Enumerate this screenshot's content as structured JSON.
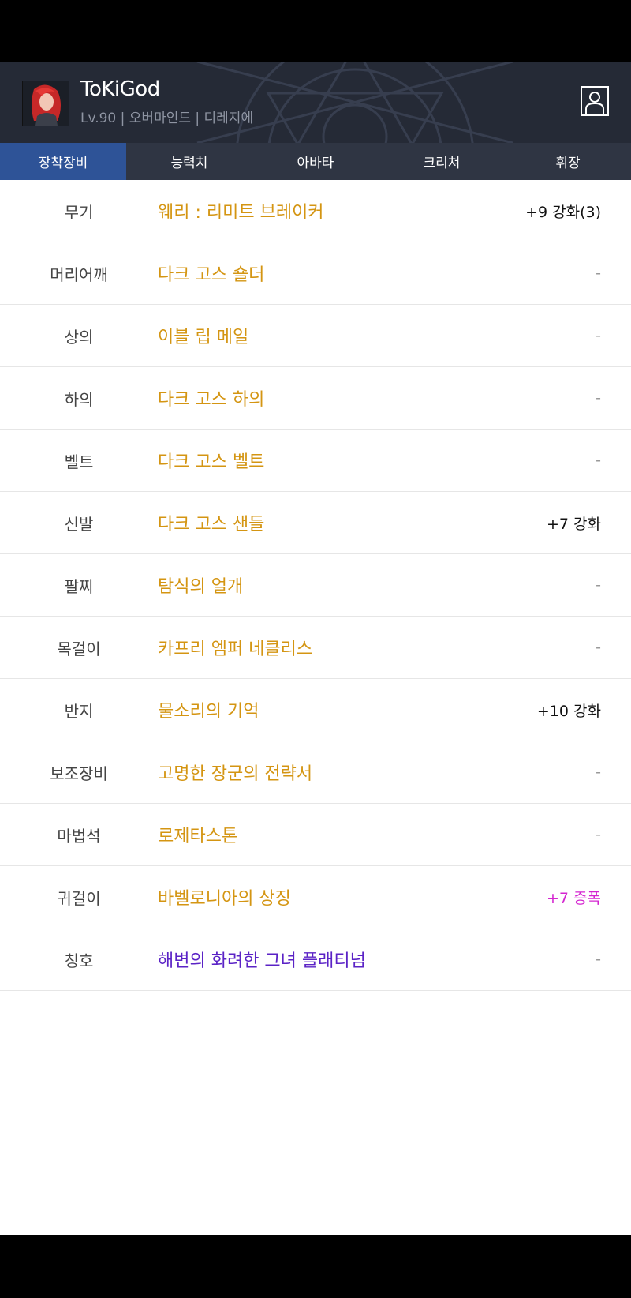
{
  "character": {
    "name": "ToKiGod",
    "info": "Lv.90 | 오버마인드 | 디레지에"
  },
  "tabs": [
    "장착장비",
    "능력치",
    "아바타",
    "크리쳐",
    "휘장"
  ],
  "equipment": [
    {
      "slot": "무기",
      "item": "웨리 : 리미트 브레이커",
      "bonus": "+9 강화(3)"
    },
    {
      "slot": "머리어깨",
      "item": "다크 고스 숄더",
      "bonus": "-"
    },
    {
      "slot": "상의",
      "item": "이블 립 메일",
      "bonus": "-"
    },
    {
      "slot": "하의",
      "item": "다크 고스 하의",
      "bonus": "-"
    },
    {
      "slot": "벨트",
      "item": "다크 고스 벨트",
      "bonus": "-"
    },
    {
      "slot": "신발",
      "item": "다크 고스 샌들",
      "bonus": "+7 강화"
    },
    {
      "slot": "팔찌",
      "item": "탐식의 얼개",
      "bonus": "-"
    },
    {
      "slot": "목걸이",
      "item": "카프리 엠퍼 네클리스",
      "bonus": "-"
    },
    {
      "slot": "반지",
      "item": "물소리의 기억",
      "bonus": "+10 강화"
    },
    {
      "slot": "보조장비",
      "item": "고명한 장군의 전략서",
      "bonus": "-"
    },
    {
      "slot": "마법석",
      "item": "로제타스톤",
      "bonus": "-"
    },
    {
      "slot": "귀걸이",
      "item": "바벨로니아의 상징",
      "bonus": "+7 증폭"
    },
    {
      "slot": "칭호",
      "item": "해변의 화려한 그녀 플래티넘",
      "bonus": "-"
    }
  ],
  "colors": {
    "item_rare": "#d49512",
    "item_purple": "#5b23c6",
    "amplify": "#d425d0",
    "active_tab": "#2e5397"
  }
}
